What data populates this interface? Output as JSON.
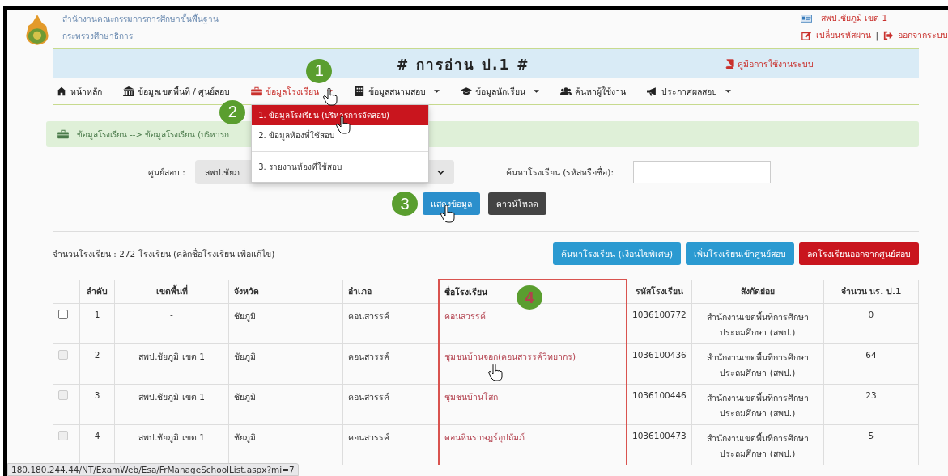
{
  "header": {
    "org_lines": [
      "สำนักงานคณะกรรมการการศึกษาขั้นพื้นฐาน",
      "กระทรวงศึกษาธิการ"
    ],
    "user": "สพป.ชัยภูมิ เขต 1",
    "links": [
      {
        "label": "เปลี่ยนรหัสผ่าน"
      },
      {
        "label": "ออกจากระบบ"
      }
    ],
    "separator": "|"
  },
  "banner": {
    "title": "# การอ่าน ป.1 #",
    "manual_link": "คู่มือการใช้งานระบบ"
  },
  "nav": [
    {
      "label": "หน้าหลัก",
      "dropdown": false,
      "selected": false,
      "hovered": false
    },
    {
      "label": "ข้อมูลเขตพื้นที่ / ศูนย์สอบ",
      "dropdown": false,
      "selected": false,
      "hovered": false
    },
    {
      "label": "ข้อมูลโรงเรียน",
      "dropdown": true,
      "selected": true,
      "hovered": true,
      "step": "1"
    },
    {
      "label": "ข้อมูลสนามสอบ",
      "dropdown": true,
      "selected": false,
      "hovered": false
    },
    {
      "label": "ข้อมูลนักเรียน",
      "dropdown": true,
      "selected": false,
      "hovered": false
    },
    {
      "label": "ค้นหาผู้ใช้งาน",
      "dropdown": false,
      "selected": false,
      "hovered": false
    },
    {
      "label": "ประกาศผลสอบ",
      "dropdown": true,
      "selected": false,
      "hovered": false
    }
  ],
  "dropdown_menu": {
    "groups": [
      [
        {
          "label": "1. ข้อมูลโรงเรียน (บริหารการจัดสอบ)",
          "selected": true,
          "hovered": true,
          "step": "2"
        },
        {
          "label": "2. ข้อมูลห้องที่ใช้สอบ",
          "selected": false,
          "hovered": false
        }
      ],
      [
        {
          "label": "3. รายงานห้องที่ใช้สอบ",
          "selected": false,
          "hovered": false
        }
      ]
    ]
  },
  "breadcrumb": "ข้อมูลโรงเรียน --> ข้อมูลโรงเรียน (บริหารก",
  "form": {
    "center_label": "ศูนย์สอบ :",
    "center_value": "สพป.ชัยภ",
    "search_label": "ค้นหาโรงเรียน (รหัสหรือชื่อ):",
    "buttons": [
      {
        "label": "แสดงข้อมูล",
        "kind": "primary",
        "hovered": true,
        "step": "3"
      },
      {
        "label": "ดาวน์โหลด",
        "kind": "dark",
        "hovered": false
      }
    ]
  },
  "count_text": "จำนวนโรงเรียน : 272 โรงเรียน (คลิกชื่อโรงเรียน เพื่อแก้ไข)",
  "actions": [
    {
      "label": "ค้นหาโรงเรียน (เงื่อนไขพิเศษ)",
      "kind": "info"
    },
    {
      "label": "เพิ่มโรงเรียนเข้าศูนย์สอบ",
      "kind": "info"
    },
    {
      "label": "ลดโรงเรียนออกจากศูนย์สอบ",
      "kind": "danger"
    }
  ],
  "table": {
    "columns": [
      {
        "label": "ลำดับ",
        "highlighted": false
      },
      {
        "label": "เขตพื้นที่",
        "highlighted": false
      },
      {
        "label": "จังหวัด",
        "highlighted": false
      },
      {
        "label": "อำเภอ",
        "highlighted": false
      },
      {
        "label": "ชื่อโรงเรียน",
        "highlighted": true,
        "step": "4"
      },
      {
        "label": "รหัสโรงเรียน",
        "highlighted": false
      },
      {
        "label": "สังกัดย่อย",
        "highlighted": false
      },
      {
        "label": "จำนวน นร. ป.1",
        "highlighted": false
      }
    ],
    "rows": [
      {
        "checked": false,
        "disabled": false,
        "hovered": false,
        "no": "1",
        "area": "-",
        "province": "ชัยภูมิ",
        "district": "คอนสวรรค์",
        "school": "คอนสวรรค์",
        "code": "1036100772",
        "affiliation": "สำนักงานเขตพื้นที่การศึกษาประถมศึกษา (สพป.)",
        "count": "0"
      },
      {
        "checked": false,
        "disabled": true,
        "hovered": true,
        "no": "2",
        "area": "สพป.ชัยภูมิ เขต 1",
        "province": "ชัยภูมิ",
        "district": "คอนสวรรค์",
        "school": "ชุมชนบ้านจอก(คอนสวรรค์วิทยากร)",
        "code": "1036100436",
        "affiliation": "สำนักงานเขตพื้นที่การศึกษาประถมศึกษา (สพป.)",
        "count": "64"
      },
      {
        "checked": false,
        "disabled": true,
        "hovered": false,
        "no": "3",
        "area": "สพป.ชัยภูมิ เขต 1",
        "province": "ชัยภูมิ",
        "district": "คอนสวรรค์",
        "school": "ชุมชนบ้านโสก",
        "code": "1036100446",
        "affiliation": "สำนักงานเขตพื้นที่การศึกษาประถมศึกษา (สพป.)",
        "count": "23"
      },
      {
        "checked": false,
        "disabled": true,
        "hovered": false,
        "no": "4",
        "area": "สพป.ชัยภูมิ เขต 1",
        "province": "ชัยภูมิ",
        "district": "คอนสวรรค์",
        "school": "ดอนหินราษฎร์อุปถัมภ์",
        "code": "1036100473",
        "affiliation": "สำนักงานเขตพื้นที่การศึกษาประถมศึกษา (สพป.)",
        "count": "5"
      }
    ]
  },
  "status_url": "180.180.244.44/NT/ExamWeb/Esa/FrManageSchoolList.aspx?mi=7"
}
